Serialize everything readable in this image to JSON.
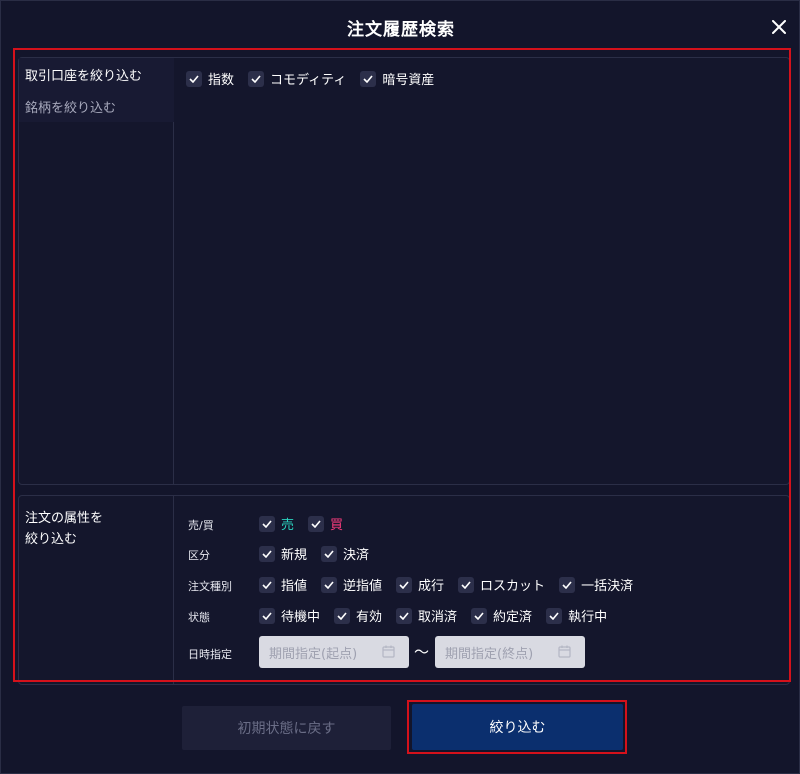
{
  "dialog": {
    "title": "注文履歴検索"
  },
  "sidebar": {
    "items": [
      {
        "label": "取引口座を絞り込む",
        "active": true
      },
      {
        "label": "銘柄を絞り込む",
        "active": false
      }
    ]
  },
  "accounts": {
    "options": [
      {
        "label": "指数",
        "checked": true
      },
      {
        "label": "コモディティ",
        "checked": true
      },
      {
        "label": "暗号資産",
        "checked": true
      }
    ]
  },
  "attributes": {
    "section_title_line1": "注文の属性を",
    "section_title_line2": "絞り込む",
    "side": {
      "label": "売/買",
      "options": [
        {
          "label": "売",
          "checked": true
        },
        {
          "label": "買",
          "checked": true
        }
      ]
    },
    "category": {
      "label": "区分",
      "options": [
        {
          "label": "新規",
          "checked": true
        },
        {
          "label": "決済",
          "checked": true
        }
      ]
    },
    "order_type": {
      "label": "注文種別",
      "options": [
        {
          "label": "指値",
          "checked": true
        },
        {
          "label": "逆指値",
          "checked": true
        },
        {
          "label": "成行",
          "checked": true
        },
        {
          "label": "ロスカット",
          "checked": true
        },
        {
          "label": "一括決済",
          "checked": true
        }
      ]
    },
    "status": {
      "label": "状態",
      "options": [
        {
          "label": "待機中",
          "checked": true
        },
        {
          "label": "有効",
          "checked": true
        },
        {
          "label": "取消済",
          "checked": true
        },
        {
          "label": "約定済",
          "checked": true
        },
        {
          "label": "執行中",
          "checked": true
        }
      ]
    },
    "date": {
      "label": "日時指定",
      "start_placeholder": "期間指定(起点)",
      "separator": "〜",
      "end_placeholder": "期間指定(終点)"
    }
  },
  "footer": {
    "reset_label": "初期状態に戻す",
    "submit_label": "絞り込む"
  },
  "colors": {
    "background": "#13152b",
    "sell": "#2bd4c0",
    "buy": "#ff3d7f",
    "submit_bg": "#0b2f6e",
    "highlight": "#d4111b"
  },
  "icons": [
    "close-icon",
    "check-icon",
    "calendar-icon"
  ]
}
